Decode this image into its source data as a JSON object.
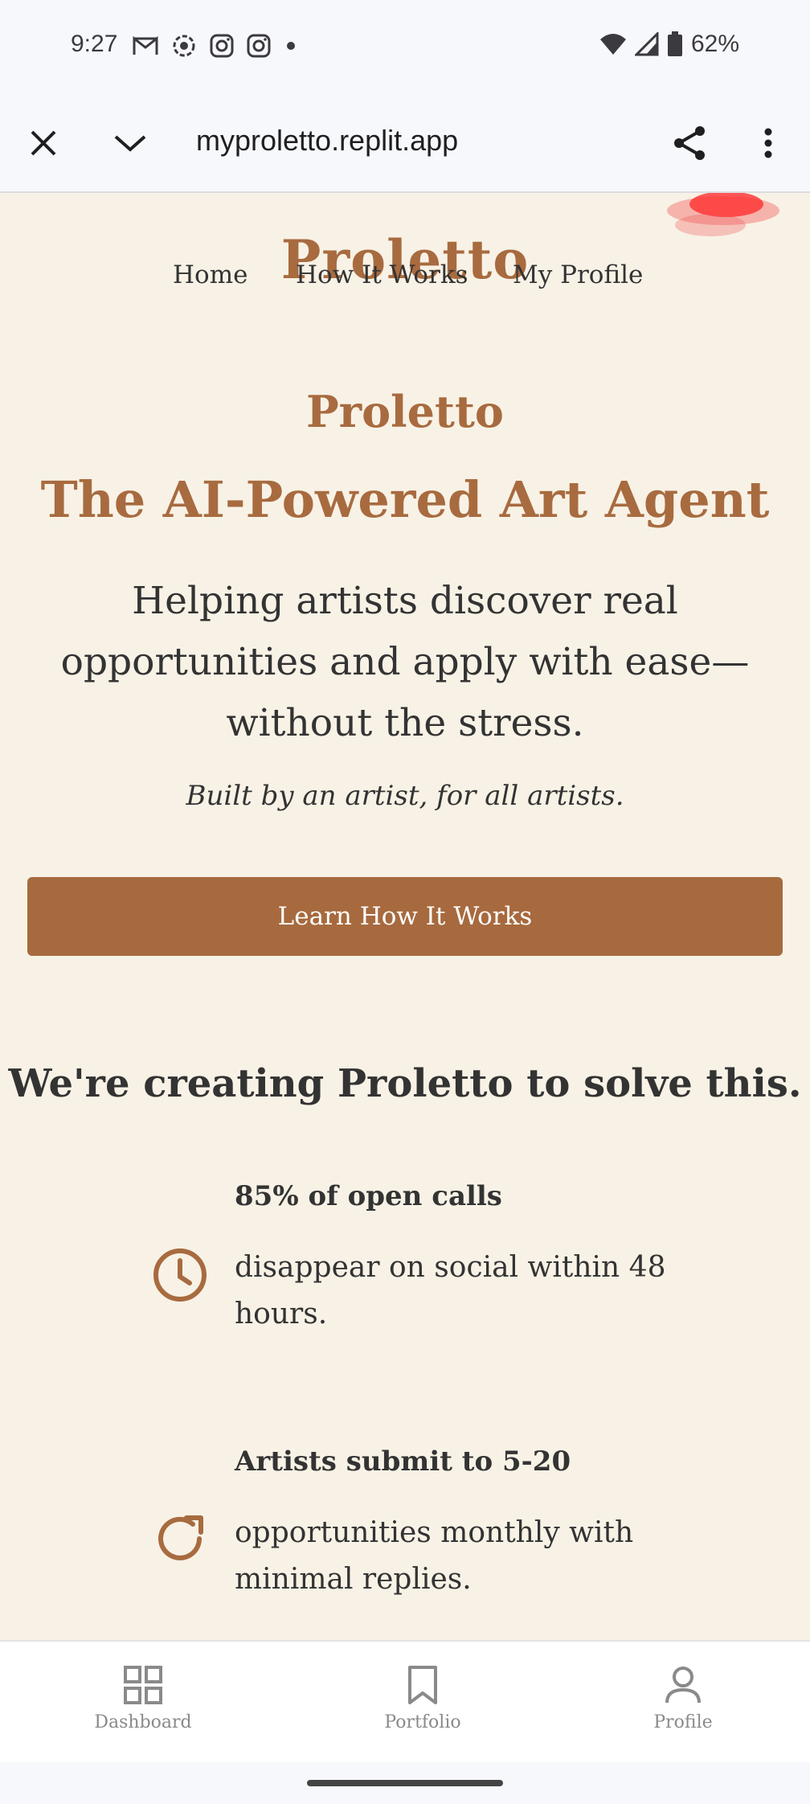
{
  "status_bar": {
    "time": "9:27",
    "battery_percent": "62%",
    "notification_icons": [
      "gmail-icon",
      "pinwheel-icon",
      "instagram-icon",
      "instagram-icon",
      "dot-icon"
    ],
    "system_icons": [
      "wifi-icon",
      "signal-icon",
      "battery-icon"
    ]
  },
  "browser": {
    "url": "myproletto.replit.app",
    "close_icon": "close-icon",
    "collapse_icon": "chevron-down-icon",
    "share_icon": "share-icon",
    "menu_icon": "more-vert-icon"
  },
  "nav": {
    "logo": "Proletto",
    "links": [
      "Home",
      "How It Works",
      "My Profile"
    ]
  },
  "hero": {
    "brand": "Proletto",
    "headline": "The AI-Powered Art Agent",
    "lede": "Helping artists discover real opportunities and apply with ease—without the stress.",
    "tagline": "Built by an artist, for all artists.",
    "cta_label": "Learn How It Works"
  },
  "problem": {
    "title": "We're creating Proletto to solve this.",
    "stats": [
      {
        "icon": "clock-icon",
        "headline": "85% of open calls",
        "body": "disappear on social within 48 hours."
      },
      {
        "icon": "refresh-icon",
        "headline": "Artists submit to 5-20",
        "body": "opportunities monthly with minimal replies."
      }
    ]
  },
  "bottom_nav": {
    "items": [
      {
        "label": "Dashboard",
        "icon": "grid-icon"
      },
      {
        "label": "Portfolio",
        "icon": "bookmark-icon"
      },
      {
        "label": "Profile",
        "icon": "person-icon"
      }
    ]
  },
  "colors": {
    "accent": "#a86a3f",
    "page_bg": "#f8f1e6",
    "text": "#333333"
  }
}
